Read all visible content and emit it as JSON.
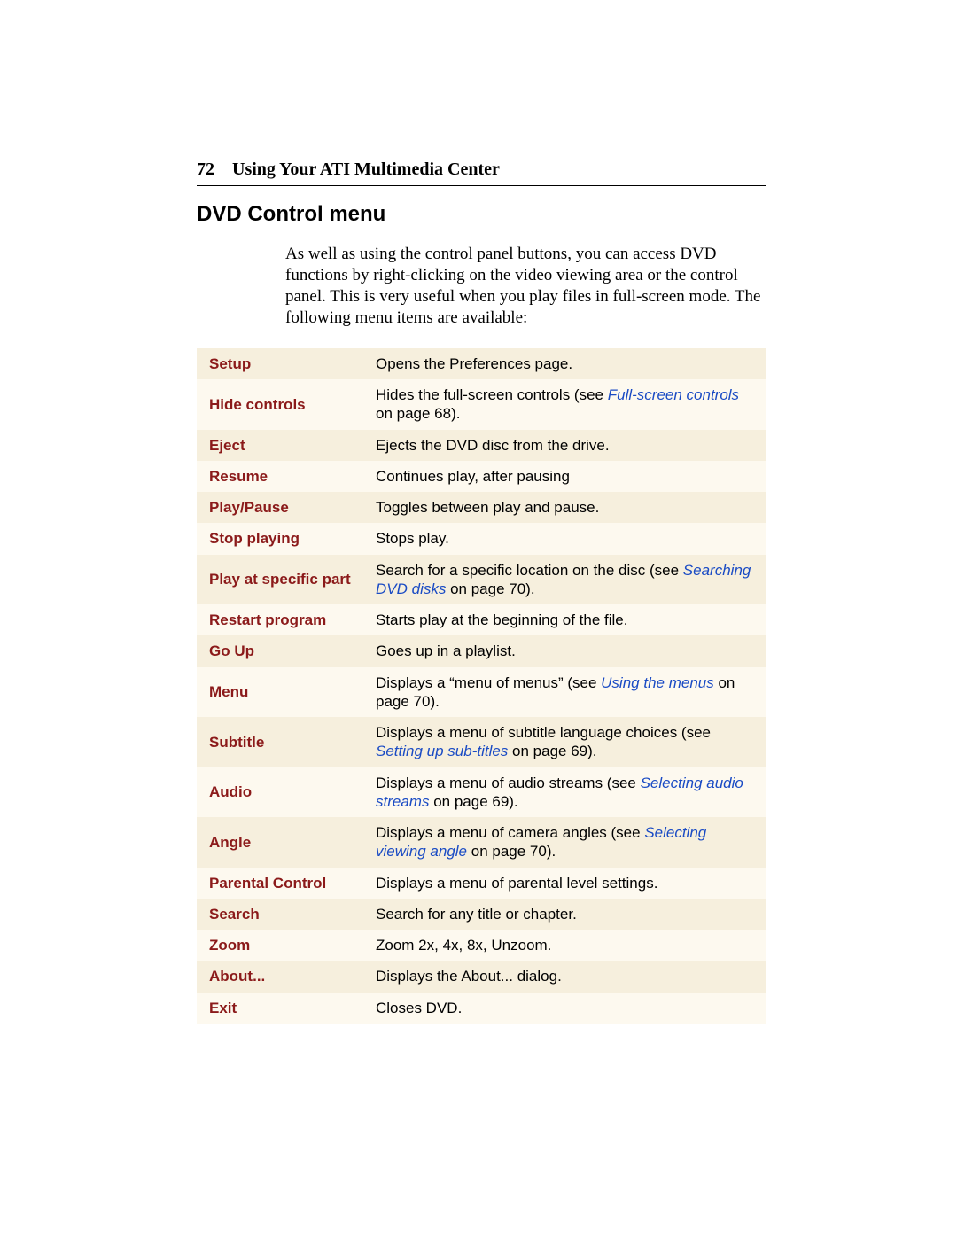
{
  "header": {
    "page_number": "72",
    "running_title": "Using Your ATI Multimedia Center"
  },
  "section_title": "DVD Control menu",
  "intro": "As well as using the control panel buttons, you can access DVD functions by right-clicking on the video viewing area or the control panel.  This is very useful when you play files in full-screen mode.  The following menu items are available:",
  "rows": [
    {
      "label": "Setup",
      "pre": "Opens the Preferences page.",
      "link": "",
      "post": ""
    },
    {
      "label": "Hide controls",
      "pre": "Hides the full-screen controls (see ",
      "link": "Full-screen controls",
      "post": " on page 68)."
    },
    {
      "label": "Eject",
      "pre": "Ejects the DVD disc from the drive.",
      "link": "",
      "post": ""
    },
    {
      "label": "Resume",
      "pre": "Continues play, after pausing",
      "link": "",
      "post": ""
    },
    {
      "label": "Play/Pause",
      "pre": "Toggles between play and pause.",
      "link": "",
      "post": ""
    },
    {
      "label": "Stop playing",
      "pre": "Stops play.",
      "link": "",
      "post": ""
    },
    {
      "label": "Play at specific part",
      "pre": "Search for a specific location on the disc (see ",
      "link": "Searching DVD disks",
      "post": " on page 70)."
    },
    {
      "label": "Restart program",
      "pre": "Starts play at the beginning of the file.",
      "link": "",
      "post": ""
    },
    {
      "label": "Go Up",
      "pre": "Goes up in a playlist.",
      "link": "",
      "post": ""
    },
    {
      "label": "Menu",
      "pre": "Displays a “menu of menus” (see ",
      "link": "Using the menus",
      "post": " on page 70)."
    },
    {
      "label": "Subtitle",
      "pre": "Displays a menu of subtitle language choices (see ",
      "link": "Setting up sub-titles",
      "post": " on page 69)."
    },
    {
      "label": "Audio",
      "pre": "Displays a menu of audio streams (see ",
      "link": "Selecting audio streams",
      "post": " on page 69)."
    },
    {
      "label": "Angle",
      "pre": "Displays a menu of camera angles (see ",
      "link": "Selecting viewing angle",
      "post": " on page 70)."
    },
    {
      "label": "Parental Control",
      "pre": "Displays a menu of parental level settings.",
      "link": "",
      "post": ""
    },
    {
      "label": "Search",
      "pre": "Search for any title or chapter.",
      "link": "",
      "post": ""
    },
    {
      "label": "Zoom",
      "pre": "Zoom 2x, 4x, 8x, Unzoom.",
      "link": "",
      "post": ""
    },
    {
      "label": "About...",
      "pre": "Displays the About... dialog.",
      "link": "",
      "post": ""
    },
    {
      "label": "Exit",
      "pre": "Closes DVD.",
      "link": "",
      "post": ""
    }
  ]
}
